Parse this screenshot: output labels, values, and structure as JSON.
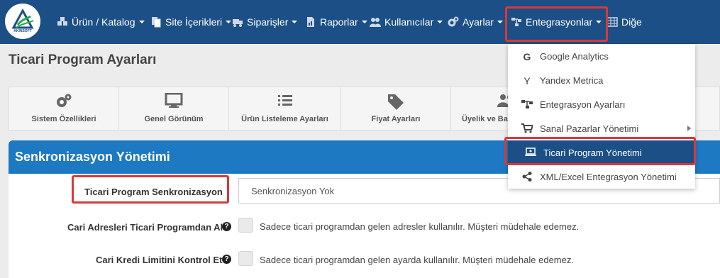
{
  "brand": {
    "logo_text": "AKINSOFT"
  },
  "nav": {
    "items": [
      {
        "label": "Ürün / Katalog",
        "icon": "cubes-icon"
      },
      {
        "label": "Site İçerikleri",
        "icon": "copy-icon"
      },
      {
        "label": "Siparişler",
        "icon": "truck-icon"
      },
      {
        "label": "Raporlar",
        "icon": "report-icon"
      },
      {
        "label": "Kullanıcılar",
        "icon": "users-icon"
      },
      {
        "label": "Ayarlar",
        "icon": "gears-icon"
      },
      {
        "label": "Entegrasyonlar",
        "icon": "sitemap-icon"
      },
      {
        "label": "Diğe",
        "icon": "grid-icon"
      }
    ]
  },
  "page": {
    "title": "Ticari Program Ayarları"
  },
  "tabs": [
    {
      "label": "Sistem Özellikleri",
      "icon": "gears-icon"
    },
    {
      "label": "Genel Görünüm",
      "icon": "monitor-icon"
    },
    {
      "label": "Ürün Listeleme Ayarları",
      "icon": "list-icon"
    },
    {
      "label": "Fiyat Ayarları",
      "icon": "tag-icon"
    },
    {
      "label": "Üyelik ve Ba",
      "icon": "users-icon"
    }
  ],
  "sync_panel": {
    "title": "Senkronizasyon Yönetimi",
    "fields": [
      {
        "label": "Ticari Program Senkronizasyon",
        "value": "Senkronizasyon Yok"
      },
      {
        "label": "Cari Adresleri Ticari Programdan Al",
        "description": "Sadece ticari programdan gelen adresler kullanılır. Müşteri müdehale edemez."
      },
      {
        "label": "Cari Kredi Limitini Kontrol Et",
        "description": "Sadece ticari programdan gelen ayarda kullanılır. Müşteri müdehale edemez."
      }
    ]
  },
  "dropdown": {
    "items": [
      {
        "label": "Google Analytics",
        "icon": "google-icon"
      },
      {
        "label": "Yandex Metrica",
        "icon": "yandex-icon"
      },
      {
        "label": "Entegrasyon Ayarları",
        "icon": "sitemap-icon"
      },
      {
        "label": "Sanal Pazarlar Yönetimi",
        "icon": "cart-icon",
        "has_submenu": true
      },
      {
        "label": "Ticari Program Yönetimi",
        "icon": "laptop-icon",
        "active": true
      },
      {
        "label": "XML/Excel Entegrasyon Yönetimi",
        "icon": "share-icon"
      }
    ]
  },
  "colors": {
    "nav_bg": "#1b4f86",
    "panel_head_bg": "#1d79c1",
    "highlight_red": "#d9383a",
    "active_item_bg": "#1b4f86"
  }
}
